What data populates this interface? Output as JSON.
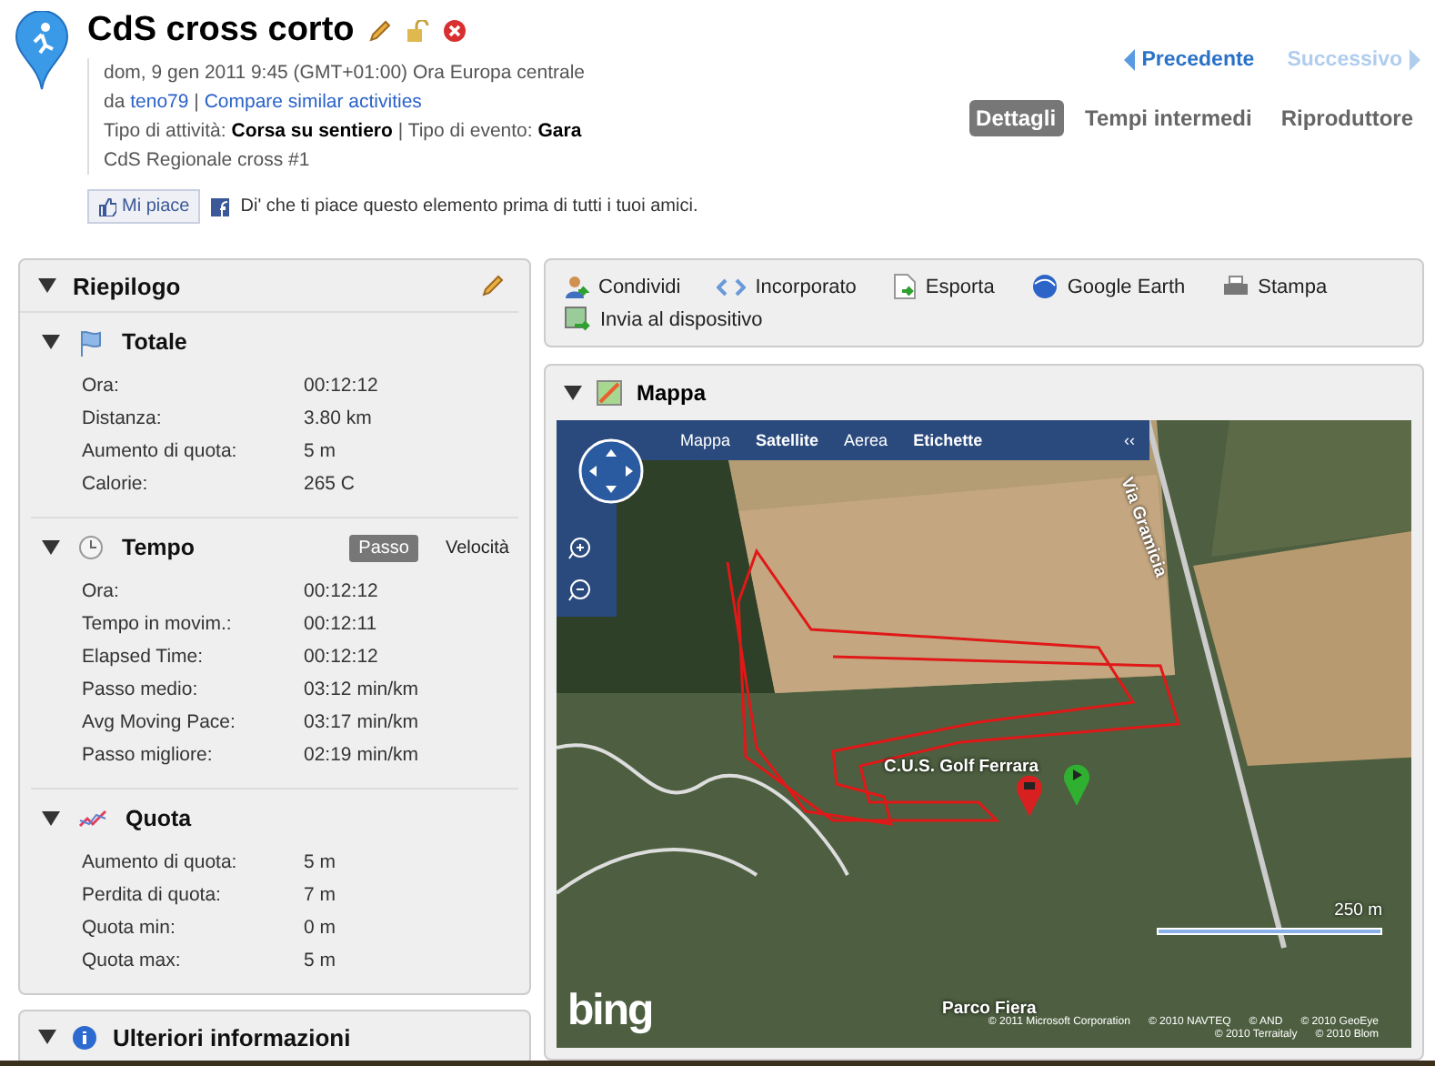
{
  "header": {
    "title": "CdS cross corto",
    "date_line": "dom, 9 gen 2011 9:45 (GMT+01:00) Ora Europa centrale",
    "author_prefix": "da",
    "author": "teno79",
    "separator": "|",
    "compare_link": "Compare similar activities",
    "activity_type_label": "Tipo di attività:",
    "activity_type": "Corsa su sentiero",
    "event_type_label": "Tipo di evento:",
    "event_type": "Gara",
    "event_name": "CdS Regionale cross #1",
    "like_button": "Mi piace",
    "like_text": "Di' che ti piace questo elemento prima di tutti i tuoi amici."
  },
  "nav": [
    {
      "label": "Precedente",
      "kind": "prev",
      "disabled": false
    },
    {
      "label": "Successivo",
      "kind": "next",
      "disabled": true
    }
  ],
  "tabs": [
    {
      "label": "Dettagli",
      "selected": true
    },
    {
      "label": "Tempi intermedi",
      "selected": false
    },
    {
      "label": "Riproduttore",
      "selected": false
    }
  ],
  "summary": {
    "title": "Riepilogo",
    "sections": [
      {
        "title": "Totale",
        "kind": "flag",
        "rows": [
          {
            "label": "Ora:",
            "value": "00:12:12"
          },
          {
            "label": "Distanza:",
            "value": "3.80 km"
          },
          {
            "label": "Aumento di quota:",
            "value": "5 m"
          },
          {
            "label": "Calorie:",
            "value": "265 C"
          }
        ]
      },
      {
        "title": "Tempo",
        "kind": "clock",
        "toggle": [
          {
            "label": "Passo",
            "selected": true
          },
          {
            "label": "Velocità",
            "selected": false
          }
        ],
        "rows": [
          {
            "label": "Ora:",
            "value": "00:12:12"
          },
          {
            "label": "Tempo in movim.:",
            "value": "00:12:11"
          },
          {
            "label": "Elapsed Time:",
            "value": "00:12:12"
          },
          {
            "label": "Passo medio:",
            "value": "03:12 min/km"
          },
          {
            "label": "Avg Moving Pace:",
            "value": "03:17 min/km"
          },
          {
            "label": "Passo migliore:",
            "value": "02:19 min/km"
          }
        ]
      },
      {
        "title": "Quota",
        "kind": "elevation",
        "rows": [
          {
            "label": "Aumento di quota:",
            "value": "5 m"
          },
          {
            "label": "Perdita di quota:",
            "value": "7 m"
          },
          {
            "label": "Quota min:",
            "value": "0 m"
          },
          {
            "label": "Quota max:",
            "value": "5 m"
          }
        ]
      }
    ]
  },
  "more_info": {
    "title": "Ulteriori informazioni"
  },
  "actions": [
    {
      "label": "Condividi",
      "kind": "share"
    },
    {
      "label": "Incorporato",
      "kind": "embed"
    },
    {
      "label": "Esporta",
      "kind": "export"
    },
    {
      "label": "Google Earth",
      "kind": "globe"
    },
    {
      "label": "Stampa",
      "kind": "print"
    },
    {
      "label": "Invia al dispositivo",
      "kind": "device"
    }
  ],
  "map": {
    "title": "Mappa",
    "modes": [
      {
        "label": "Mappa",
        "selected": false
      },
      {
        "label": "Satellite",
        "selected": true
      },
      {
        "label": "Aerea",
        "selected": false
      }
    ],
    "labels_toggle": "Etichette",
    "collapse": "‹‹",
    "road_label": "Via Gramicia",
    "place_label": "C.U.S. Golf Ferrara",
    "park_label": "Parco Fiera",
    "scale": "250 m",
    "logo": "bing",
    "attributions": [
      "© 2011 Microsoft Corporation",
      "© 2010 NAVTEQ",
      "© AND",
      "© 2010 GeoEye",
      "© 2010 Terraitaly",
      "© 2010 Blom"
    ]
  }
}
